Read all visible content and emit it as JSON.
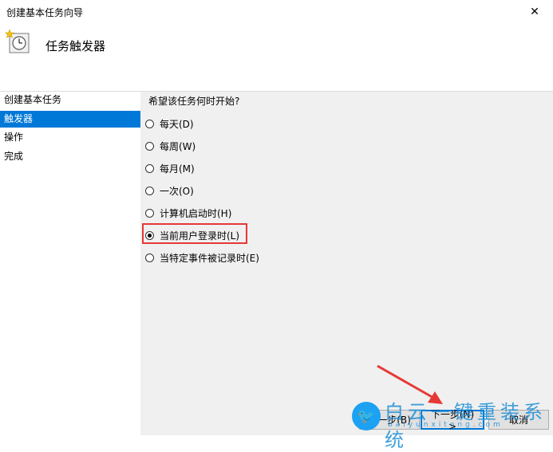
{
  "window": {
    "title": "创建基本任务向导",
    "close_glyph": "✕"
  },
  "header": {
    "title": "任务触发器",
    "icon": "clock-wizard-icon"
  },
  "sidebar": {
    "items": [
      {
        "label": "创建基本任务",
        "active": false
      },
      {
        "label": "触发器",
        "active": true
      },
      {
        "label": "操作",
        "active": false
      },
      {
        "label": "完成",
        "active": false
      }
    ]
  },
  "content": {
    "question": "希望该任务何时开始?",
    "options": [
      {
        "label": "每天(D)",
        "checked": false
      },
      {
        "label": "每周(W)",
        "checked": false
      },
      {
        "label": "每月(M)",
        "checked": false
      },
      {
        "label": "一次(O)",
        "checked": false
      },
      {
        "label": "计算机启动时(H)",
        "checked": false
      },
      {
        "label": "当前用户登录时(L)",
        "checked": true
      },
      {
        "label": "当特定事件被记录时(E)",
        "checked": false
      }
    ]
  },
  "buttons": {
    "back": "上一步(B)",
    "next": "下一步(N) >",
    "cancel": "取消"
  },
  "watermark": {
    "text": "白云一键重装系统",
    "url": "baiyunxitong.com"
  },
  "colors": {
    "accent": "#0078d7",
    "highlight": "#e53935",
    "watermark": "#1d8fd8"
  }
}
